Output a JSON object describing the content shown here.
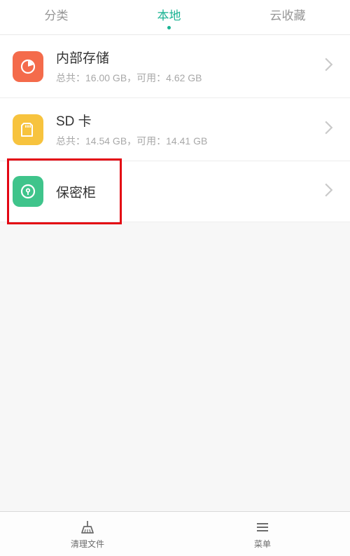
{
  "tabs": {
    "category": "分类",
    "local": "本地",
    "cloud": "云收藏",
    "activeIndex": 1
  },
  "storage": {
    "internal": {
      "title": "内部存储",
      "subtitle": "总共：16.00 GB，可用：4.62 GB"
    },
    "sd": {
      "title": "SD 卡",
      "subtitle": "总共：14.54 GB，可用：14.41 GB"
    },
    "safe": {
      "title": "保密柜"
    }
  },
  "bottom": {
    "clean": "清理文件",
    "menu": "菜单"
  },
  "colors": {
    "accent": "#1ab393",
    "internalIcon": "#f46b4b",
    "sdIcon": "#f7c33e",
    "safeIcon": "#3fc48b",
    "highlight": "#e30613"
  }
}
